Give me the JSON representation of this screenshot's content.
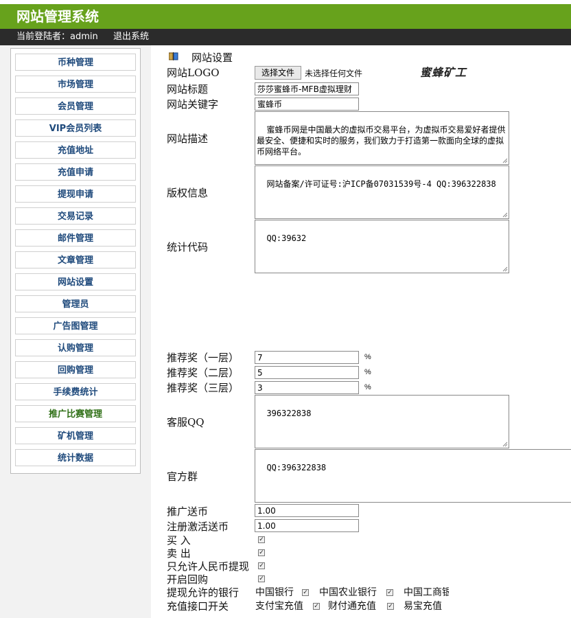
{
  "app": {
    "title": "网站管理系统",
    "logged_in": "当前登陆者：admin",
    "logout": "退出系统"
  },
  "sidebar": {
    "items": [
      {
        "label": "币种管理"
      },
      {
        "label": "市场管理"
      },
      {
        "label": "会员管理"
      },
      {
        "label": "VIP会员列表"
      },
      {
        "label": "充值地址"
      },
      {
        "label": "充值申请"
      },
      {
        "label": "提现申请"
      },
      {
        "label": "交易记录"
      },
      {
        "label": "邮件管理"
      },
      {
        "label": "文章管理"
      },
      {
        "label": "网站设置"
      },
      {
        "label": "管理员"
      },
      {
        "label": "广告图管理"
      },
      {
        "label": "认购管理"
      },
      {
        "label": "回购管理"
      },
      {
        "label": "手续费统计"
      },
      {
        "label": "推广比赛管理"
      },
      {
        "label": "矿机管理"
      },
      {
        "label": "统计数据"
      }
    ]
  },
  "page": {
    "header": "网站设置",
    "logo_text": "蜜蜂矿工"
  },
  "form": {
    "logo_label": "网站LOGO",
    "file_button": "选择文件",
    "file_status": "未选择任何文件",
    "title_label": "网站标题",
    "title_value": "莎莎蜜蜂币-MFB虚拟理财",
    "keywords_label": "网站关键字",
    "keywords_value": "蜜蜂币",
    "desc_label": "网站描述",
    "desc_value": "蜜蜂币网是中国最大的虚拟币交易平台，为虚拟币交易爱好者提供最安全、便捷和实时的服务，我们致力于打造第一款面向全球的虚拟币网络平台。",
    "copyright_label": "版权信息",
    "copyright_value": "网站备案/许可证号:沪ICP备07031539号-4 QQ:396322838",
    "stats_label": "统计代码",
    "stats_value": "QQ:39632",
    "reward1_label": "推荐奖（一层）",
    "reward1_value": "7",
    "reward2_label": "推荐奖（二层）",
    "reward2_value": "5",
    "reward3_label": "推荐奖（三层）",
    "reward3_value": "3",
    "percent": "%",
    "qq_label": "客服QQ",
    "qq_value": "396322838",
    "group_label": "官方群",
    "group_value": "QQ:396322838",
    "promo_label": "推广送币",
    "promo_value": "1.00",
    "register_label": "注册激活送币",
    "register_value": "1.00",
    "buy_label": "买 入",
    "sell_label": "卖 出",
    "rmb_only_label": "只允许人民币提现",
    "buyback_label": "开启回购",
    "banks_label": "提现允许的银行",
    "bank1": "中国银行",
    "bank2": "中国农业银行",
    "bank3": "中国工商银行",
    "recharge_label": "充值接口开关",
    "pay1": "支付宝充值",
    "pay2": "财付通充值",
    "pay3": "易宝充值"
  }
}
